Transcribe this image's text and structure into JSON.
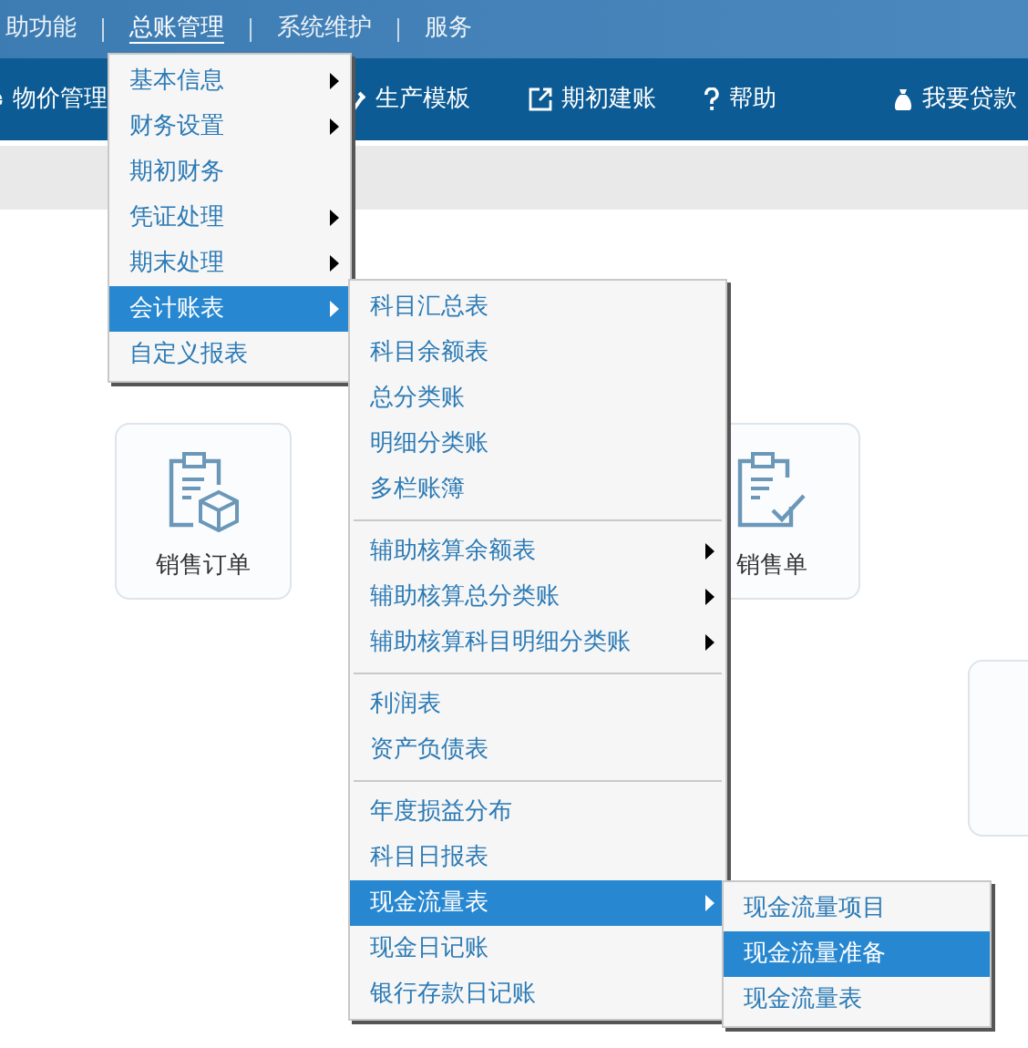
{
  "top_menu": [
    {
      "label": "助功能",
      "selected": false
    },
    {
      "label": "总账管理",
      "selected": true
    },
    {
      "label": "系统维护",
      "selected": false
    },
    {
      "label": "服务",
      "selected": false
    }
  ],
  "toolbar": [
    {
      "label": "物价管理",
      "kind": "gear"
    },
    {
      "label": "生产模板",
      "kind": "wrench"
    },
    {
      "label": "期初建账",
      "kind": "external"
    },
    {
      "label": "帮助",
      "kind": "help"
    },
    {
      "label": "我要贷款",
      "kind": "bag"
    }
  ],
  "cards": [
    {
      "label": "销售订单",
      "kind": "box"
    },
    {
      "label": "销售单",
      "kind": "check"
    },
    {
      "kind": "blank"
    }
  ],
  "menu": [
    {
      "label": "基本信息",
      "submenu": true,
      "selected": false
    },
    {
      "label": "财务设置",
      "submenu": true,
      "selected": false
    },
    {
      "label": "期初财务",
      "submenu": false,
      "selected": false
    },
    {
      "label": "凭证处理",
      "submenu": true,
      "selected": false
    },
    {
      "label": "期末处理",
      "submenu": true,
      "selected": false
    },
    {
      "label": "会计账表",
      "submenu": true,
      "selected": true
    },
    {
      "label": "自定义报表",
      "submenu": false,
      "selected": false
    }
  ],
  "submenu": {
    "groups": [
      [
        {
          "label": "科目汇总表",
          "submenu": false,
          "selected": false
        },
        {
          "label": "科目余额表",
          "submenu": false,
          "selected": false
        },
        {
          "label": "总分类账",
          "submenu": false,
          "selected": false
        },
        {
          "label": "明细分类账",
          "submenu": false,
          "selected": false
        },
        {
          "label": "多栏账簿",
          "submenu": false,
          "selected": false
        }
      ],
      [
        {
          "label": "辅助核算余额表",
          "submenu": true,
          "selected": false
        },
        {
          "label": "辅助核算总分类账",
          "submenu": true,
          "selected": false
        },
        {
          "label": "辅助核算科目明细分类账",
          "submenu": true,
          "selected": false
        }
      ],
      [
        {
          "label": "利润表",
          "submenu": false,
          "selected": false
        },
        {
          "label": "资产负债表",
          "submenu": false,
          "selected": false
        }
      ],
      [
        {
          "label": "年度损益分布",
          "submenu": false,
          "selected": false
        },
        {
          "label": "科目日报表",
          "submenu": false,
          "selected": false
        },
        {
          "label": "现金流量表",
          "submenu": true,
          "selected": true
        },
        {
          "label": "现金日记账",
          "submenu": false,
          "selected": false
        },
        {
          "label": "银行存款日记账",
          "submenu": false,
          "selected": false
        }
      ]
    ]
  },
  "cashflow_menu": [
    {
      "label": "现金流量项目",
      "selected": false
    },
    {
      "label": "现金流量准备",
      "selected": true
    },
    {
      "label": "现金流量表",
      "selected": false
    }
  ]
}
